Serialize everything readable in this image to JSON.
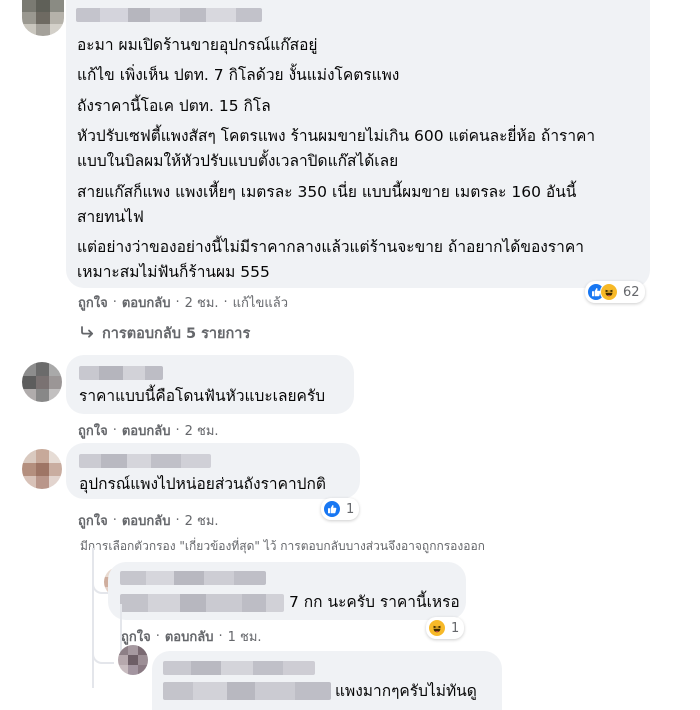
{
  "comment_main": {
    "lines": [
      "อะมา ผมเปิดร้านขายอุปกรณ์แก๊สอยู่",
      "แก้ไข เพิ่งเห็น ปตท. 7 กิโลด้วย งั้นแม่งโคตรแพง",
      "ถังราคานี้โอเค ปตท. 15 กิโล",
      "หัวปรับเซฟตี้แพงสัสๆ โคตรแพง ร้านผมขายไม่เกิน 600 แต่คนละยี่ห้อ ถ้าราคา",
      "แบบในบิลผมให้หัวปรับแบบตั้งเวลาปิดแก๊สได้เลย",
      "สายแก๊สก็แพง แพงเหี้ยๆ เมตรละ 350 เนี่ย แบบนี้ผมขาย เมตรละ 160 อันนี้",
      "สายทนไฟ",
      "แต่อย่างว่าของอย่างนี้ไม่มีราคากลางแล้วแต่ร้านจะขาย ถ้าอยากได้ของราคา",
      "เหมาะสมไม่ฟันก็ร้านผม 555"
    ],
    "like": "ถูกใจ",
    "reply": "ตอบกลับ",
    "time": "2 ชม.",
    "edited": "แก้ไขแล้ว",
    "reaction_count": "62",
    "reaction_icons": [
      "like-icon",
      "haha-icon"
    ]
  },
  "view_replies": "การตอบกลับ 5 รายการ",
  "comment_2": {
    "text": "ราคาแบบนี้คือโดนฟันหัวแบะเลยครับ",
    "like": "ถูกใจ",
    "reply": "ตอบกลับ",
    "time": "2 ชม."
  },
  "comment_3": {
    "text": "อุปกรณ์แพงไปหน่อยส่วนถังราคาปกติ",
    "like": "ถูกใจ",
    "reply": "ตอบกลับ",
    "time": "2 ชม.",
    "reaction_count": "1",
    "reaction_icons": [
      "like-icon"
    ]
  },
  "filter_note": "มีการเลือกตัวกรอง \"เกี่ยวข้องที่สุด\" ไว้ การตอบกลับบางส่วนจึงอาจถูกกรองออก",
  "reply_1": {
    "text": "7 กก นะครับ ราคานี้เหรอ",
    "like": "ถูกใจ",
    "reply": "ตอบกลับ",
    "time": "1 ชม.",
    "reaction_count": "1",
    "reaction_icons": [
      "haha-icon"
    ]
  },
  "reply_2": {
    "text": "แพงมากๆครับไม่ทันดู"
  },
  "colors": {
    "bubble": "#f0f2f5",
    "text": "#050505",
    "meta": "#65676b",
    "like_blue": "#1877f2",
    "haha_yellow": "#f7b928"
  }
}
